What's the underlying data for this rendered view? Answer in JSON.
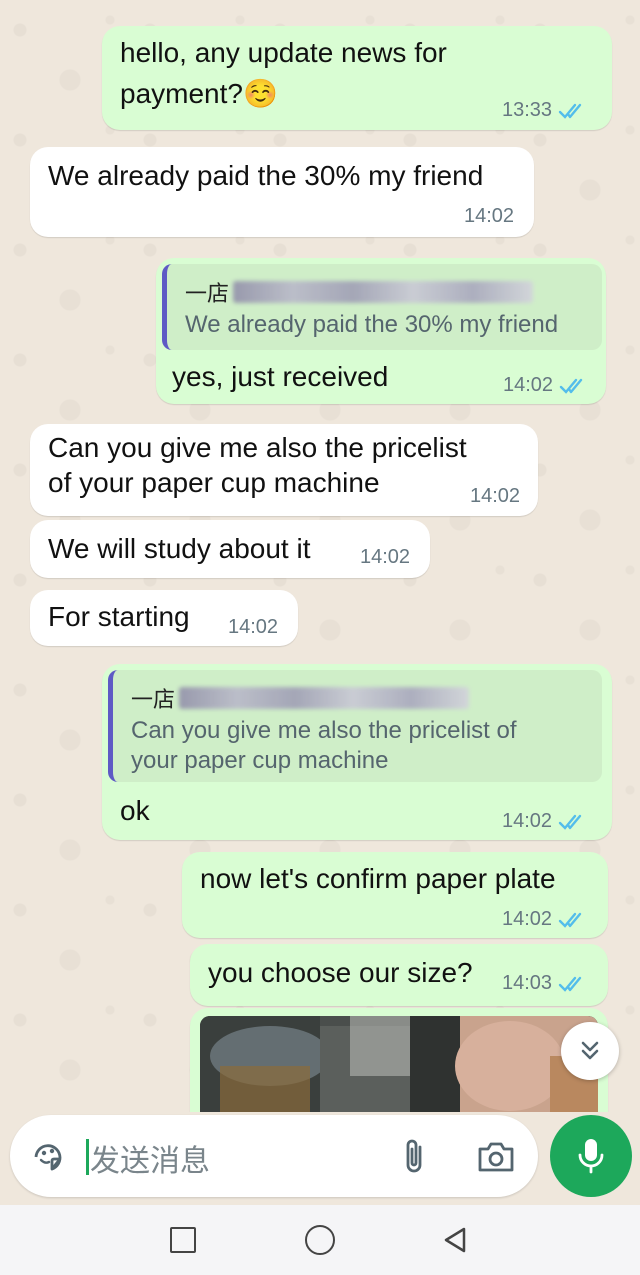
{
  "messages": [
    {
      "dir": "out",
      "text": "hello, any update news for payment?😊",
      "line1": "hello, any update news for",
      "line2": "payment?",
      "emoji": "☺️",
      "time": "13:33",
      "read": true
    },
    {
      "dir": "in",
      "text": "We already paid the 30% my friend",
      "time": "14:02"
    },
    {
      "dir": "out",
      "quote_author": "一店",
      "quote_text": "We already paid the 30% my friend",
      "text": "yes, just received",
      "time": "14:02",
      "read": true
    },
    {
      "dir": "in",
      "line1": "Can you give me also the pricelist",
      "line2": "of your paper cup machine",
      "time": "14:02"
    },
    {
      "dir": "in",
      "text": "We will study about it",
      "time": "14:02"
    },
    {
      "dir": "in",
      "text": "For starting",
      "time": "14:02"
    },
    {
      "dir": "out",
      "quote_author": "一店",
      "quote_line1": "Can you give me also the pricelist of",
      "quote_line2": "your paper cup machine",
      "text": "ok",
      "time": "14:02",
      "read": true
    },
    {
      "dir": "out",
      "text": "now let's confirm paper plate",
      "time": "14:02",
      "read": true
    },
    {
      "dir": "out",
      "text": "you choose our size?",
      "time": "14:03",
      "read": true
    }
  ],
  "composer": {
    "placeholder": "发送消息",
    "sticker_icon": "sticker-icon",
    "attach_icon": "paperclip-icon",
    "camera_icon": "camera-icon",
    "mic_icon": "microphone-icon"
  },
  "colors": {
    "outgoing_bubble": "#d9fdd3",
    "incoming_bubble": "#ffffff",
    "read_ticks": "#53bdeb",
    "mic_button": "#1da85b",
    "quote_bar": "#5e5ac5"
  },
  "navbar": {
    "icons": [
      "recents-square-icon",
      "home-circle-icon",
      "back-triangle-icon"
    ]
  }
}
